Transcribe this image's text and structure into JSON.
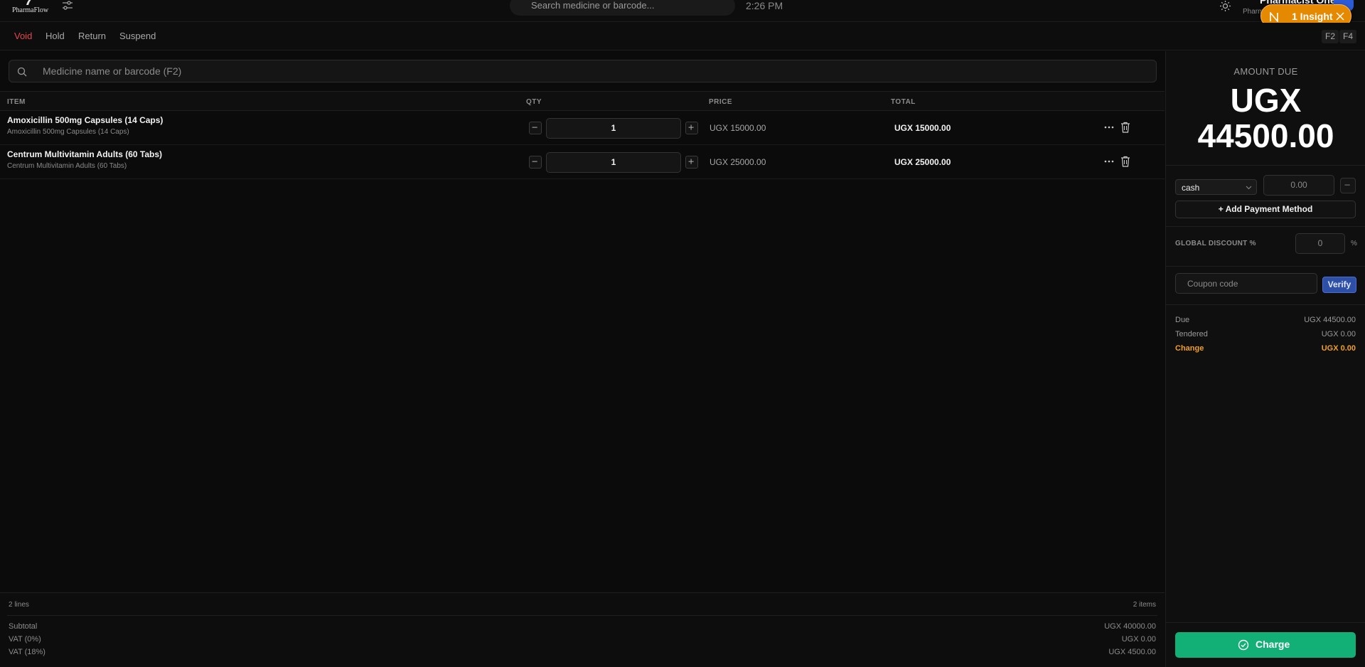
{
  "app": {
    "brand": "PharmaFlow"
  },
  "topbar": {
    "search_placeholder": "Search medicine or barcode...",
    "clock": "2:26 PM",
    "user_name": "Pharmacist One",
    "user_sub": "Pharmacist",
    "insight_label": "1 Insight"
  },
  "actions": {
    "void": "Void",
    "hold": "Hold",
    "return": "Return",
    "suspend": "Suspend",
    "shortcut_f2": "F2",
    "shortcut_f4": "F4"
  },
  "cart": {
    "search_placeholder": "Medicine name or barcode (F2)",
    "columns": {
      "item": "ITEM",
      "qty": "QTY",
      "price": "PRICE",
      "total": "TOTAL"
    },
    "rows": [
      {
        "name": "Amoxicillin 500mg Capsules (14 Caps)",
        "sub": "Amoxicillin 500mg Capsules (14 Caps)",
        "qty": "1",
        "price": "UGX 15000.00",
        "total": "UGX 15000.00"
      },
      {
        "name": "Centrum Multivitamin Adults (60 Tabs)",
        "sub": "Centrum Multivitamin Adults (60 Tabs)",
        "qty": "1",
        "price": "UGX 25000.00",
        "total": "UGX 25000.00"
      }
    ]
  },
  "footer": {
    "lines": "2 lines",
    "items": "2 items",
    "subtotal_label": "Subtotal",
    "subtotal_value": "UGX 40000.00",
    "vat0_label": "VAT (0%)",
    "vat0_value": "UGX 0.00",
    "vat18_label": "VAT (18%)",
    "vat18_value": "UGX 4500.00"
  },
  "panel": {
    "amount_label": "AMOUNT DUE",
    "amount_value": "UGX 44500.00",
    "payment_method": "cash",
    "payment_amount_placeholder": "0.00",
    "add_payment": "+ Add Payment Method",
    "discount_label": "GLOBAL DISCOUNT %",
    "discount_value": "0",
    "discount_unit": "%",
    "coupon_placeholder": "Coupon code",
    "verify": "Verify",
    "due_label": "Due",
    "due_value": "UGX 44500.00",
    "tendered_label": "Tendered",
    "tendered_value": "UGX 0.00",
    "change_label": "Change",
    "change_value": "UGX 0.00",
    "charge": "Charge"
  },
  "colors": {
    "void": "#e5484d",
    "insight": "#e58a00",
    "charge": "#12b076",
    "verify": "#2d4fa6",
    "change": "#f0a020"
  }
}
